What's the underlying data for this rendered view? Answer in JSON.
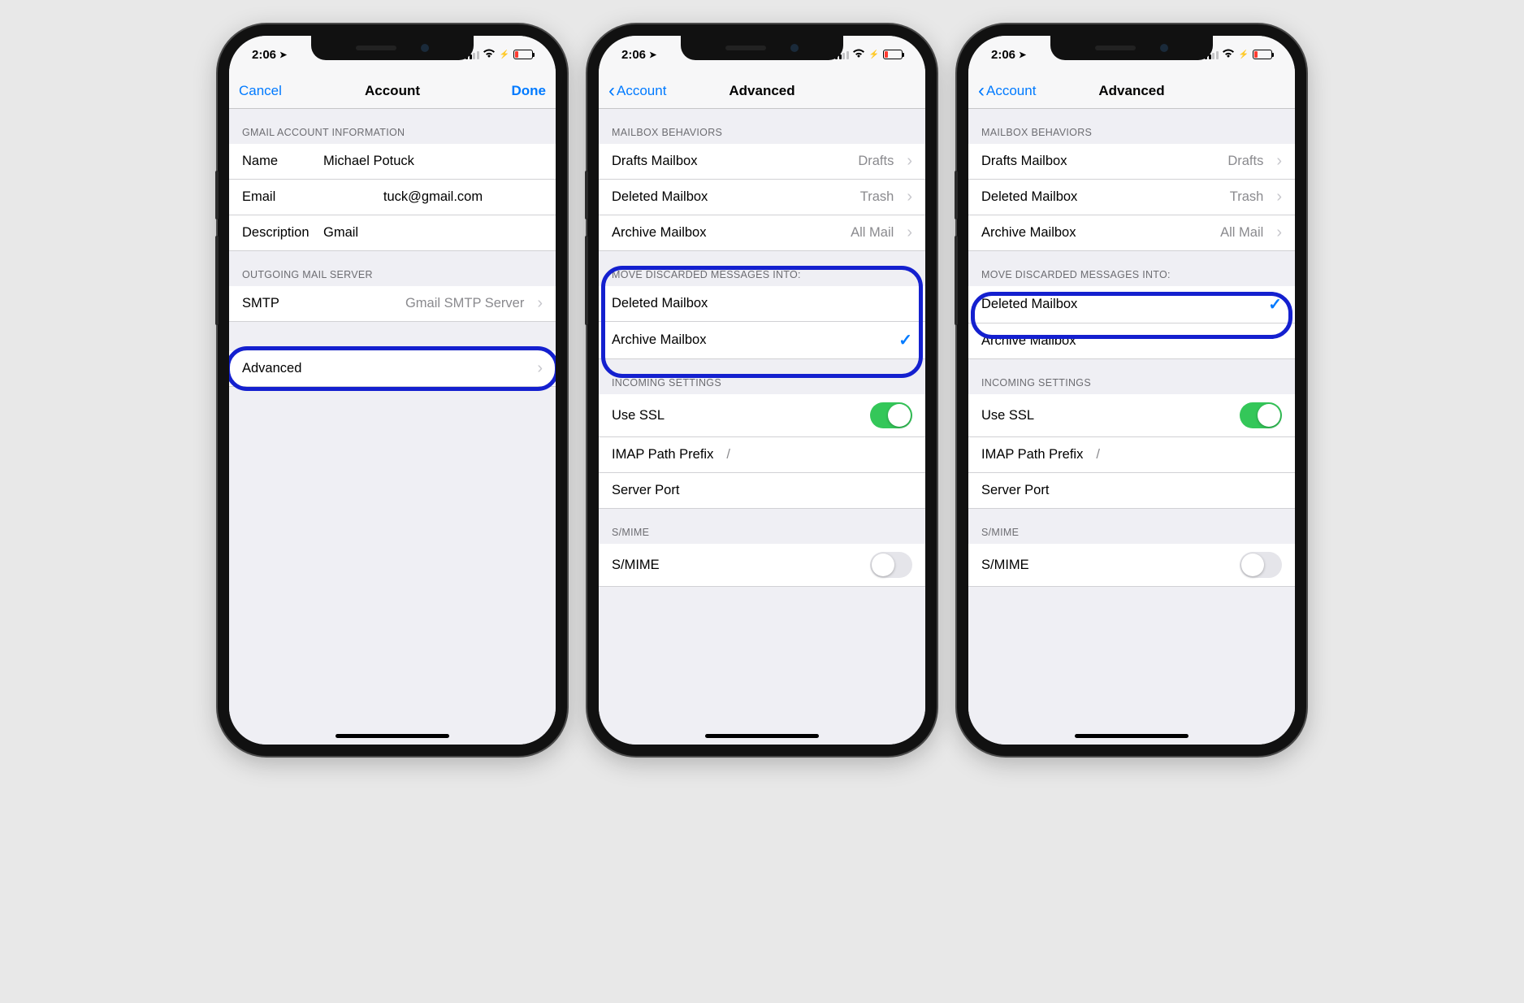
{
  "status": {
    "time": "2:06",
    "loc_icon": "➤"
  },
  "screen1": {
    "nav": {
      "left": "Cancel",
      "title": "Account",
      "right": "Done"
    },
    "sect1_header": "Gmail Account Information",
    "rows1": {
      "name_label": "Name",
      "name_value": "Michael Potuck",
      "email_label": "Email",
      "email_value": "tuck@gmail.com",
      "desc_label": "Description",
      "desc_value": "Gmail"
    },
    "sect2_header": "Outgoing Mail Server",
    "rows2": {
      "smtp_label": "SMTP",
      "smtp_value": "Gmail SMTP Server"
    },
    "rows3": {
      "advanced_label": "Advanced"
    }
  },
  "screen2": {
    "nav": {
      "back": "Account",
      "title": "Advanced"
    },
    "sect1_header": "Mailbox Behaviors",
    "mb": {
      "drafts_label": "Drafts Mailbox",
      "drafts_value": "Drafts",
      "deleted_label": "Deleted Mailbox",
      "deleted_value": "Trash",
      "archive_label": "Archive Mailbox",
      "archive_value": "All Mail"
    },
    "sect2_header": "Move Discarded Messages Into:",
    "discard": {
      "deleted": "Deleted Mailbox",
      "archive": "Archive Mailbox",
      "selected": "archive"
    },
    "sect3_header": "Incoming Settings",
    "incoming": {
      "ssl_label": "Use SSL",
      "ssl_on": true,
      "imap_label": "IMAP Path Prefix",
      "imap_value": "/",
      "port_label": "Server Port"
    },
    "sect4_header": "S/MIME",
    "smime": {
      "label": "S/MIME",
      "on": false
    }
  },
  "screen3": {
    "nav": {
      "back": "Account",
      "title": "Advanced"
    },
    "sect1_header": "Mailbox Behaviors",
    "mb": {
      "drafts_label": "Drafts Mailbox",
      "drafts_value": "Drafts",
      "deleted_label": "Deleted Mailbox",
      "deleted_value": "Trash",
      "archive_label": "Archive Mailbox",
      "archive_value": "All Mail"
    },
    "sect2_header": "Move Discarded Messages Into:",
    "discard": {
      "deleted": "Deleted Mailbox",
      "archive": "Archive Mailbox",
      "selected": "deleted"
    },
    "sect3_header": "Incoming Settings",
    "incoming": {
      "ssl_label": "Use SSL",
      "ssl_on": true,
      "imap_label": "IMAP Path Prefix",
      "imap_value": "/",
      "port_label": "Server Port"
    },
    "sect4_header": "S/MIME",
    "smime": {
      "label": "S/MIME",
      "on": false
    }
  }
}
